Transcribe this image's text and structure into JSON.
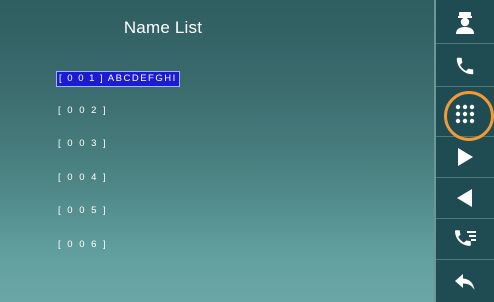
{
  "title": "Name List",
  "entries": [
    {
      "label": "[ 0 0 1 ] ABCDEFGHI",
      "selected": true
    },
    {
      "label": "[ 0 0 2 ]",
      "selected": false
    },
    {
      "label": "[ 0 0 3 ]",
      "selected": false
    },
    {
      "label": "[ 0 0 4 ]",
      "selected": false
    },
    {
      "label": "[ 0 0 5 ]",
      "selected": false
    },
    {
      "label": "[ 0 0 6 ]",
      "selected": false
    }
  ],
  "sidebar": [
    {
      "name": "guard-icon"
    },
    {
      "name": "phone-call-icon"
    },
    {
      "name": "keypad-icon"
    },
    {
      "name": "play-forward-icon"
    },
    {
      "name": "play-back-icon"
    },
    {
      "name": "call-log-icon"
    },
    {
      "name": "back-arrow-icon"
    }
  ],
  "colors": {
    "selection": "#1b1bd6",
    "highlight_ring": "#f29a38",
    "sidebar": "#1f4c52"
  }
}
